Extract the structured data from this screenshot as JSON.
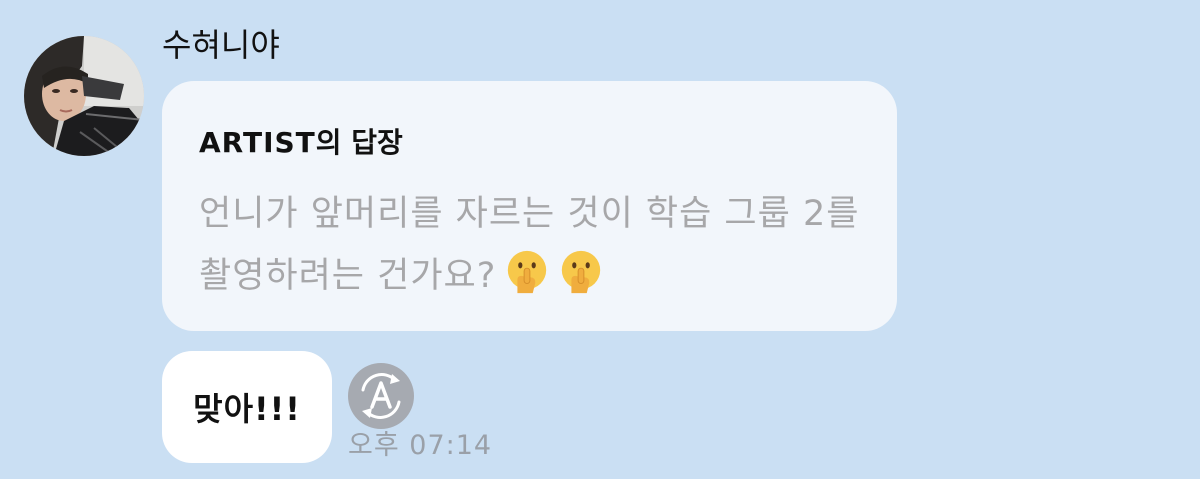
{
  "sender": {
    "name": "수혀니야"
  },
  "reply": {
    "header_artist": "ARTIST",
    "header_suffix": "의 답장",
    "quoted_text": "언니가 앞머리를 자르는 것이 학습 그룹 2를 촬영하려는 건가요?",
    "emojis": [
      "shushing-face-icon",
      "shushing-face-icon"
    ]
  },
  "message": {
    "text": "맞아!!!"
  },
  "meta": {
    "auto_translate_icon": "auto-translate-icon",
    "timestamp": "오후 07:14"
  },
  "colors": {
    "background": "#cadff3",
    "reply_bubble": "#f2f6fb",
    "message_bubble": "#ffffff",
    "quoted_text": "#a7a7a9",
    "icon_gray": "#a6aab1"
  }
}
